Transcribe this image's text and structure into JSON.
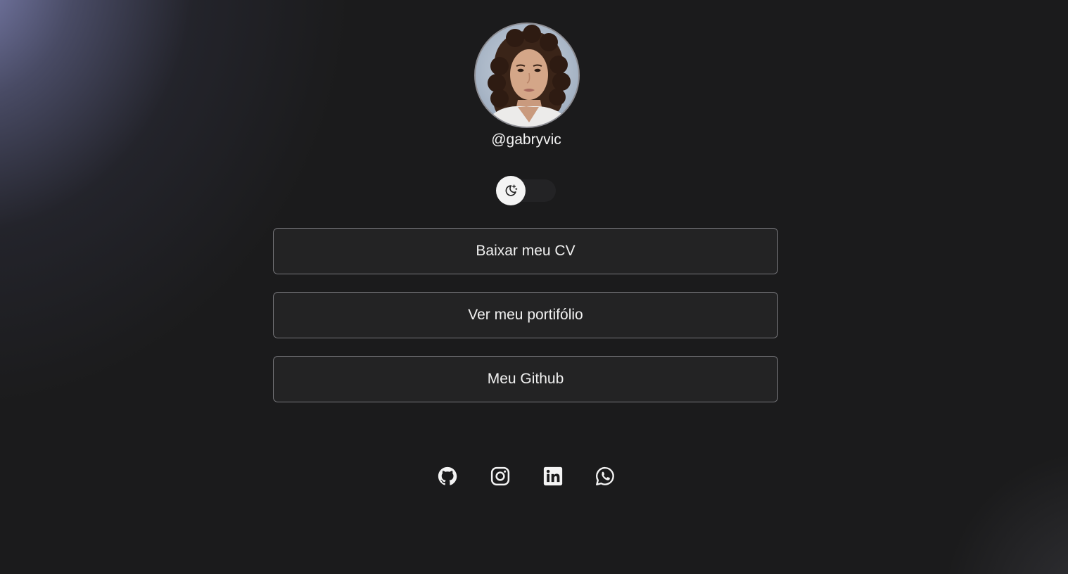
{
  "profile": {
    "username": "@gabryvic"
  },
  "theme_toggle": {
    "icon": "moon-stars-icon",
    "state": "dark"
  },
  "links": [
    {
      "label": "Baixar meu CV"
    },
    {
      "label": "Ver meu portifólio"
    },
    {
      "label": "Meu Github"
    }
  ],
  "social": [
    {
      "icon": "github-icon"
    },
    {
      "icon": "instagram-icon"
    },
    {
      "icon": "linkedin-icon"
    },
    {
      "icon": "whatsapp-icon"
    }
  ],
  "colors": {
    "background": "#1b1b1c",
    "button_bg": "#232324",
    "button_border": "#77777b",
    "glow": "#868abe"
  }
}
